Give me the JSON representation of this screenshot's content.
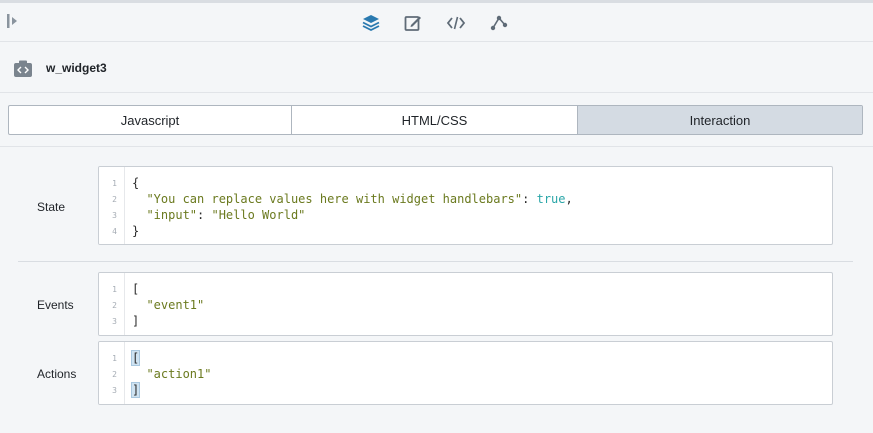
{
  "toolbar": {
    "collapse_icon": "panel-collapse-icon",
    "tools": [
      {
        "name": "layers-icon",
        "active": true
      },
      {
        "name": "edit-icon",
        "active": false
      },
      {
        "name": "code-icon",
        "active": false
      },
      {
        "name": "connection-icon",
        "active": false
      }
    ]
  },
  "widget": {
    "icon": "widget-code-icon",
    "title": "w_widget3"
  },
  "tabs": [
    {
      "label": "Javascript",
      "active": false
    },
    {
      "label": "HTML/CSS",
      "active": false
    },
    {
      "label": "Interaction",
      "active": true
    }
  ],
  "state": {
    "label": "State",
    "line_numbers": [
      "1",
      "2",
      "3",
      "4"
    ],
    "lines": {
      "l1_open": "{",
      "l2_key": "\"You can replace values here with widget handlebars\"",
      "l2_colon": ": ",
      "l2_value": "true",
      "l2_comma": ",",
      "l3_key": "\"input\"",
      "l3_colon": ": ",
      "l3_value": "\"Hello World\"",
      "l4_close": "}"
    }
  },
  "events": {
    "label": "Events",
    "line_numbers": [
      "1",
      "2",
      "3"
    ],
    "lines": {
      "l1_open": "[",
      "l2_value": "\"event1\"",
      "l3_close": "]"
    }
  },
  "actions": {
    "label": "Actions",
    "line_numbers": [
      "1",
      "2",
      "3"
    ],
    "lines": {
      "l1_open": "[",
      "l2_value": "\"action1\"",
      "l3_close": "]"
    }
  },
  "colors": {
    "accent": "#2a7ab0",
    "icon_gray": "#5f6b77",
    "active_tab": "#d4dbe3",
    "string": "#6b7a1f",
    "keyword": "#2aa6a8"
  }
}
